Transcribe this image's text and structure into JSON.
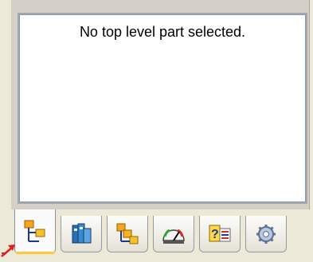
{
  "panel": {
    "message": "No top level part selected."
  },
  "tabs": [
    {
      "name": "tree-icon",
      "active": true
    },
    {
      "name": "library-icon",
      "active": false
    },
    {
      "name": "parts-icon",
      "active": false
    },
    {
      "name": "gauge-icon",
      "active": false
    },
    {
      "name": "help-list-icon",
      "active": false
    },
    {
      "name": "settings-icon",
      "active": false
    }
  ],
  "colors": {
    "panel_border": "#a7a6aa",
    "active_tab_underline": "#ffc73c",
    "arrow": "#e02020"
  }
}
